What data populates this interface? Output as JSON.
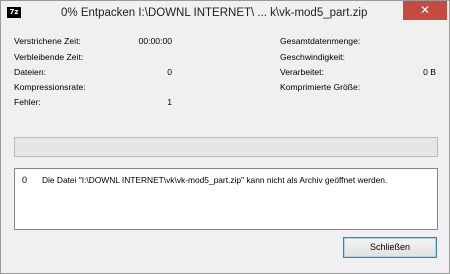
{
  "window": {
    "icon_text": "7z",
    "title": "0% Entpacken I:\\DOWNL INTERNET\\ ... k\\vk-mod5_part.zip",
    "close_glyph": "✕"
  },
  "stats_left": [
    {
      "label": "Verstrichene Zeit:",
      "value": "00:00:00"
    },
    {
      "label": "Verbleibende Zeit:",
      "value": ""
    },
    {
      "label": "Dateien:",
      "value": "0"
    },
    {
      "label": "Kompressionsrate:",
      "value": ""
    },
    {
      "label": "Fehler:",
      "value": "1"
    }
  ],
  "stats_right": [
    {
      "label": "Gesamtdatenmenge:",
      "value": ""
    },
    {
      "label": "Geschwindigkeit:",
      "value": ""
    },
    {
      "label": "Verarbeitet:",
      "value": "0 B"
    },
    {
      "label": "Komprimierte Größe:",
      "value": ""
    }
  ],
  "progress": {
    "percent": 0,
    "fill_color": "#06b025"
  },
  "log": [
    {
      "num": "0",
      "message": "Die Datei \"I:\\DOWNL INTERNET\\vk\\vk-mod5_part.zip\" kann nicht als Archiv geöffnet werden."
    }
  ],
  "buttons": {
    "close_label": "Schließen"
  },
  "colors": {
    "close_button": "#c74a40",
    "button_border": "#3c7fb1"
  }
}
